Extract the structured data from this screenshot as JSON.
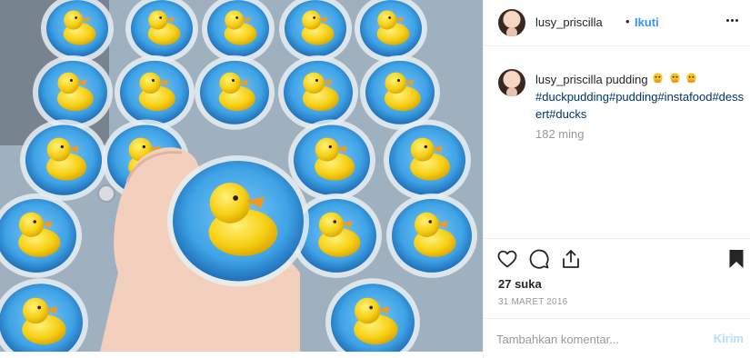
{
  "post": {
    "image_alt": "Duck pudding cups",
    "colors": {
      "jelly": "#3fa3e6",
      "duck": "#f7d117",
      "beak": "#f39a1e",
      "link": "#003569",
      "follow": "#3897f0"
    }
  },
  "header": {
    "username": "lusy_priscilla",
    "separator": "•",
    "follow_label": "Ikuti",
    "more_icon": "ellipsis-icon"
  },
  "caption": {
    "username": "lusy_priscilla",
    "text": "pudding",
    "emoji": [
      "duck-face-emoji",
      "duck-face-emoji",
      "duck-face-emoji"
    ],
    "hashtags": "#duckpudding#pudding#instafood#dessert#ducks",
    "time_ago": "182 ming"
  },
  "actions": {
    "like_icon": "heart-icon",
    "comment_icon": "comment-icon",
    "share_icon": "share-icon",
    "save_icon": "bookmark-icon",
    "likes": "27 suka",
    "date": "31 MARET 2016"
  },
  "comment": {
    "placeholder": "Tambahkan komentar...",
    "post_label": "Kirim"
  }
}
